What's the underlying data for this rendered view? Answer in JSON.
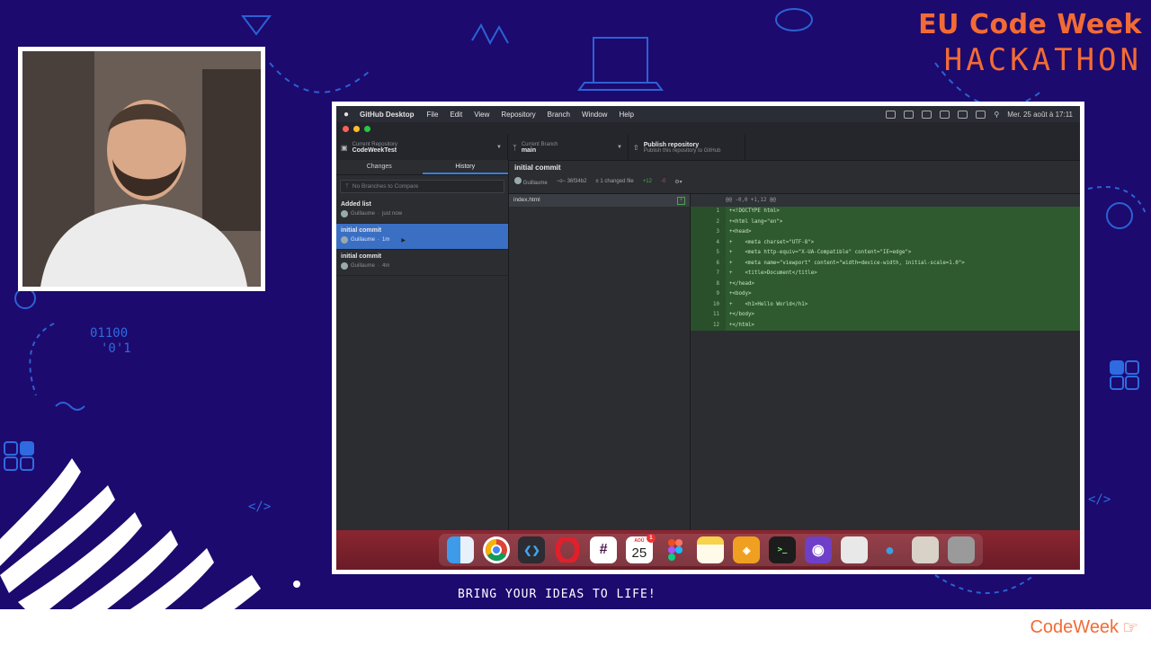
{
  "brand": {
    "line1": "EU Code Week",
    "line2": "HACKATHON"
  },
  "tagline": "BRING YOUR IDEAS TO LIFE!",
  "footer_logo": "CodeWeek",
  "colors": {
    "background": "#1c0a6e",
    "brand_orange": "#f26b35",
    "accent_blue": "#3a6fc4",
    "diff_green": "#2f5a30"
  },
  "menubar": {
    "app": "GitHub Desktop",
    "menus": [
      "File",
      "Edit",
      "View",
      "Repository",
      "Branch",
      "Window",
      "Help"
    ],
    "datetime": "Mer. 25 août à 17:11"
  },
  "toolbar": {
    "repo_label": "Current Repository",
    "repo_value": "CodeWeekTest",
    "branch_label": "Current Branch",
    "branch_value": "main",
    "publish_title": "Publish repository",
    "publish_sub": "Publish this repository to GitHub"
  },
  "tabs": {
    "changes": "Changes",
    "history": "History"
  },
  "compare_placeholder": "No Branches to Compare",
  "commits": [
    {
      "title": "Added list",
      "author": "Guillaume",
      "time": "just now"
    },
    {
      "title": "initial commit",
      "author": "Guillaume",
      "time": "1m"
    },
    {
      "title": "initial commit",
      "author": "Guillaume",
      "time": "4m"
    }
  ],
  "commit_detail": {
    "title": "initial commit",
    "author": "Guillaume",
    "sha": "36f34b2",
    "files_changed": "1 changed file",
    "additions": "+12",
    "deletions": "-0"
  },
  "file": {
    "name": "index.html"
  },
  "diff": {
    "hunk": "@@ -0,0 +1,12 @@",
    "lines": [
      "+<!DOCTYPE html>",
      "+<html lang=\"en\">",
      "+<head>",
      "+    <meta charset=\"UTF-8\">",
      "+    <meta http-equiv=\"X-UA-Compatible\" content=\"IE=edge\">",
      "+    <meta name=\"viewport\" content=\"width=device-width, initial-scale=1.0\">",
      "+    <title>Document</title>",
      "+</head>",
      "+<body>",
      "+    <h1>Hello World</h1>",
      "+</body>",
      "+</html>"
    ],
    "line_numbers": [
      "1",
      "2",
      "3",
      "4",
      "5",
      "6",
      "7",
      "8",
      "9",
      "10",
      "11",
      "12"
    ]
  },
  "dock": {
    "apps": [
      "finder-icon",
      "chrome-icon",
      "vscode-icon",
      "opera-icon",
      "slack-icon",
      "calendar-icon",
      "figma-icon",
      "notes-icon",
      "tableplus-icon",
      "terminal-icon",
      "github-icon",
      "file-icon",
      "webex-icon",
      "archive-icon",
      "trash-icon"
    ],
    "calendar_month": "AOÛ",
    "calendar_day": "25",
    "calendar_badge": "1"
  }
}
